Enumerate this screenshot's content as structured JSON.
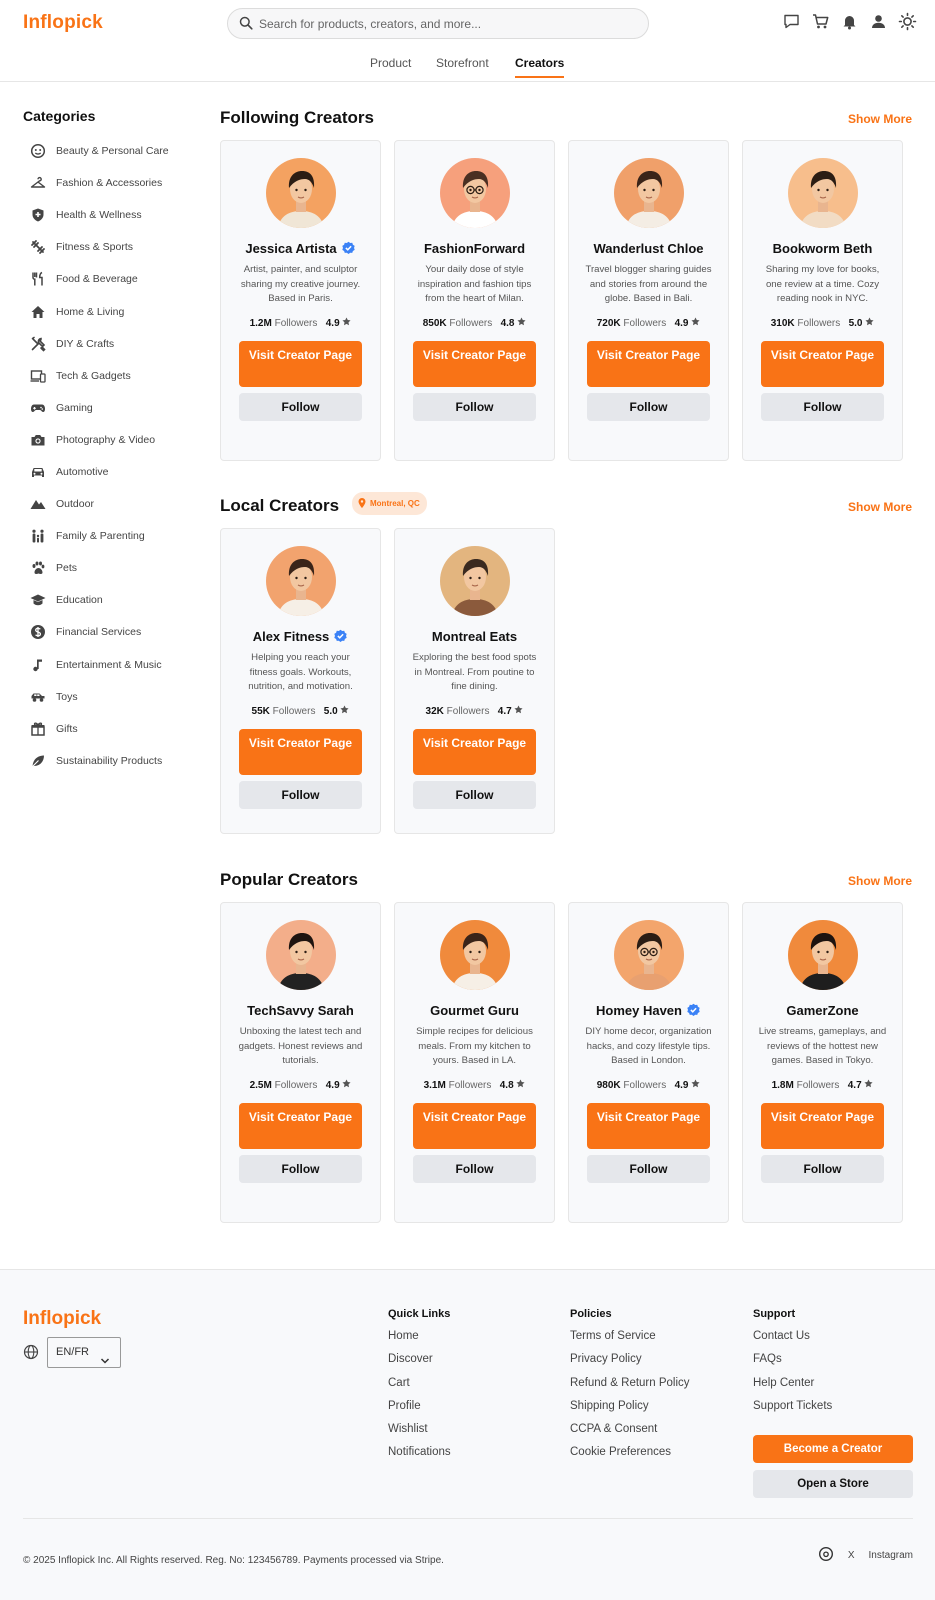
{
  "header": {
    "logo": "Inflopick",
    "search_placeholder": "Search for products, creators, and more...",
    "icons": [
      "message-icon",
      "cart-icon",
      "bell-icon",
      "user-icon",
      "sun-icon"
    ],
    "tabs": [
      "Product",
      "Storefront",
      "Creators"
    ],
    "active_tab": "Creators"
  },
  "sidebar": {
    "title": "Categories",
    "items": [
      {
        "label": "Beauty & Personal Care",
        "icon": "face-icon"
      },
      {
        "label": "Fashion & Accessories",
        "icon": "hanger-icon"
      },
      {
        "label": "Health & Wellness",
        "icon": "shield-plus-icon"
      },
      {
        "label": "Fitness & Sports",
        "icon": "dumbbell-icon"
      },
      {
        "label": "Food & Beverage",
        "icon": "utensils-icon"
      },
      {
        "label": "Home & Living",
        "icon": "home-icon"
      },
      {
        "label": "DIY & Crafts",
        "icon": "tools-icon"
      },
      {
        "label": "Tech & Gadgets",
        "icon": "devices-icon"
      },
      {
        "label": "Gaming",
        "icon": "gamepad-icon"
      },
      {
        "label": "Photography & Video",
        "icon": "camera-icon"
      },
      {
        "label": "Automotive",
        "icon": "car-icon"
      },
      {
        "label": "Outdoor",
        "icon": "mountain-icon"
      },
      {
        "label": "Family & Parenting",
        "icon": "family-icon"
      },
      {
        "label": "Pets",
        "icon": "paw-icon"
      },
      {
        "label": "Education",
        "icon": "graduation-cap-icon"
      },
      {
        "label": "Financial Services",
        "icon": "dollar-icon"
      },
      {
        "label": "Entertainment & Music",
        "icon": "music-note-icon"
      },
      {
        "label": "Toys",
        "icon": "toy-car-icon"
      },
      {
        "label": "Gifts",
        "icon": "gift-icon"
      },
      {
        "label": "Sustainability Products",
        "icon": "leaf-icon"
      }
    ]
  },
  "labels": {
    "followers": "Followers",
    "visit": "Visit Creator Page",
    "follow": "Follow",
    "show_more": "Show More"
  },
  "sections": [
    {
      "title": "Following Creators",
      "creators": [
        {
          "name": "Jessica Artista",
          "verified": true,
          "bio": "Artist, painter, and sculptor sharing my creative journey. Based in Paris.",
          "followers": "1.2M",
          "rating": "4.9",
          "avatar_bg": "#f4a261",
          "shirt": "#f0e6d6",
          "hair": "#2b1d14",
          "glasses": false
        },
        {
          "name": "FashionForward",
          "verified": false,
          "bio": "Your daily dose of style inspiration and fashion tips from the heart of Milan.",
          "followers": "850K",
          "rating": "4.8",
          "avatar_bg": "#f6a07c",
          "shirt": "#ffffff",
          "hair": "#4a2f22",
          "glasses": true
        },
        {
          "name": "Wanderlust Chloe",
          "verified": false,
          "bio": "Travel blogger sharing guides and stories from around the globe. Based in Bali.",
          "followers": "720K",
          "rating": "4.9",
          "avatar_bg": "#f0a06a",
          "shirt": "#f4ede4",
          "hair": "#3a2419",
          "glasses": false
        },
        {
          "name": "Bookworm Beth",
          "verified": false,
          "bio": "Sharing my love for books, one review at a time. Cozy reading nook in NYC.",
          "followers": "310K",
          "rating": "5.0",
          "avatar_bg": "#f7be8c",
          "shirt": "#f2dcc4",
          "hair": "#2b1d14",
          "glasses": false
        }
      ]
    },
    {
      "title": "Local Creators",
      "location": "Montreal, QC",
      "creators": [
        {
          "name": "Alex Fitness",
          "verified": true,
          "bio": "Helping you reach your fitness goals. Workouts, nutrition, and motivation.",
          "followers": "55K",
          "rating": "5.0",
          "avatar_bg": "#f2a36e",
          "shirt": "#f6efe6",
          "hair": "#3a2419",
          "glasses": false
        },
        {
          "name": "Montreal Eats",
          "verified": false,
          "bio": "Exploring the best food spots in Montreal. From poutine to fine dining.",
          "followers": "32K",
          "rating": "4.7",
          "avatar_bg": "#e3b57f",
          "shirt": "#8b5a3c",
          "hair": "#3a2a20",
          "glasses": false
        }
      ]
    },
    {
      "title": "Popular Creators",
      "creators": [
        {
          "name": "TechSavvy Sarah",
          "verified": false,
          "bio": "Unboxing the latest tech and gadgets. Honest reviews and tutorials.",
          "followers": "2.5M",
          "rating": "4.9",
          "avatar_bg": "#f3ae8a",
          "shirt": "#222222",
          "hair": "#1e1410",
          "glasses": false
        },
        {
          "name": "Gourmet Guru",
          "verified": false,
          "bio": "Simple recipes for delicious meals. From my kitchen to yours. Based in LA.",
          "followers": "3.1M",
          "rating": "4.8",
          "avatar_bg": "#f08a3c",
          "shirt": "#f6efe6",
          "hair": "#3a2419",
          "glasses": false
        },
        {
          "name": "Homey Haven",
          "verified": true,
          "bio": "DIY home decor, organization hacks, and cozy lifestyle tips. Based in London.",
          "followers": "980K",
          "rating": "4.9",
          "avatar_bg": "#f3a56c",
          "shirt": "#e8a070",
          "hair": "#2b1d14",
          "glasses": true
        },
        {
          "name": "GamerZone",
          "verified": false,
          "bio": "Live streams, gameplays, and reviews of the hottest new games. Based in Tokyo.",
          "followers": "1.8M",
          "rating": "4.7",
          "avatar_bg": "#f08a3c",
          "shirt": "#1e1e1e",
          "hair": "#1e1410",
          "glasses": false
        }
      ]
    }
  ],
  "footer": {
    "logo": "Inflopick",
    "language": "EN/FR",
    "columns": [
      {
        "title": "Quick Links",
        "links": [
          "Home",
          "Discover",
          "Cart",
          "Profile",
          "Wishlist",
          "Notifications"
        ]
      },
      {
        "title": "Policies",
        "links": [
          "Terms of Service",
          "Privacy Policy",
          "Refund & Return Policy",
          "Shipping Policy",
          "CCPA & Consent",
          "Cookie Preferences"
        ]
      },
      {
        "title": "Support",
        "links": [
          "Contact Us",
          "FAQs",
          "Help Center",
          "Support Tickets"
        ]
      }
    ],
    "become_creator": "Become a Creator",
    "open_store": "Open a Store",
    "copyright": "© 2025 Inflopick Inc. All Rights reserved. Reg. No: 123456789. Payments processed via Stripe.",
    "social": [
      "Threads",
      "X",
      "Instagram"
    ]
  },
  "colors": {
    "accent": "#f97316",
    "verified": "#3b82f6"
  }
}
